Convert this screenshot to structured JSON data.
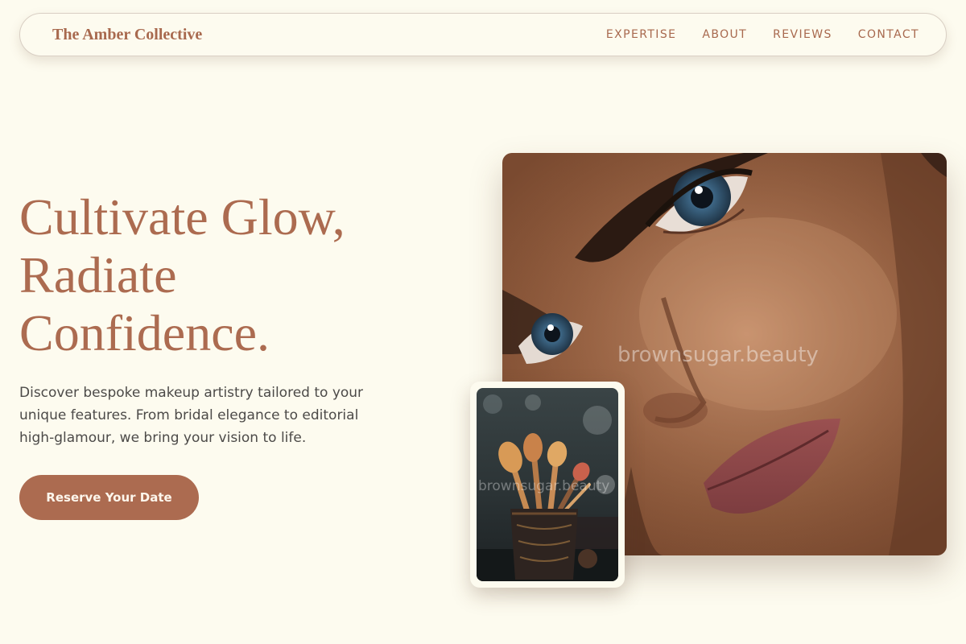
{
  "nav": {
    "brand": "The Amber Collective",
    "links": [
      {
        "label": "EXPERTISE"
      },
      {
        "label": "ABOUT"
      },
      {
        "label": "REVIEWS"
      },
      {
        "label": "CONTACT"
      }
    ]
  },
  "hero": {
    "title_lines": [
      "Cultivate Glow,",
      "Radiate",
      "Confidence."
    ],
    "description": "Discover bespoke makeup artistry tailored to your unique features. From bridal elegance to editorial high-glamour, we bring your vision to life.",
    "cta_label": "Reserve Your Date"
  },
  "images": {
    "main_watermark": "brownsugar.beauty",
    "inset_watermark": "brownsugar.beauty"
  },
  "colors": {
    "background": "#fdfbef",
    "accent": "#ac6b50",
    "text": "#4c4a48"
  }
}
